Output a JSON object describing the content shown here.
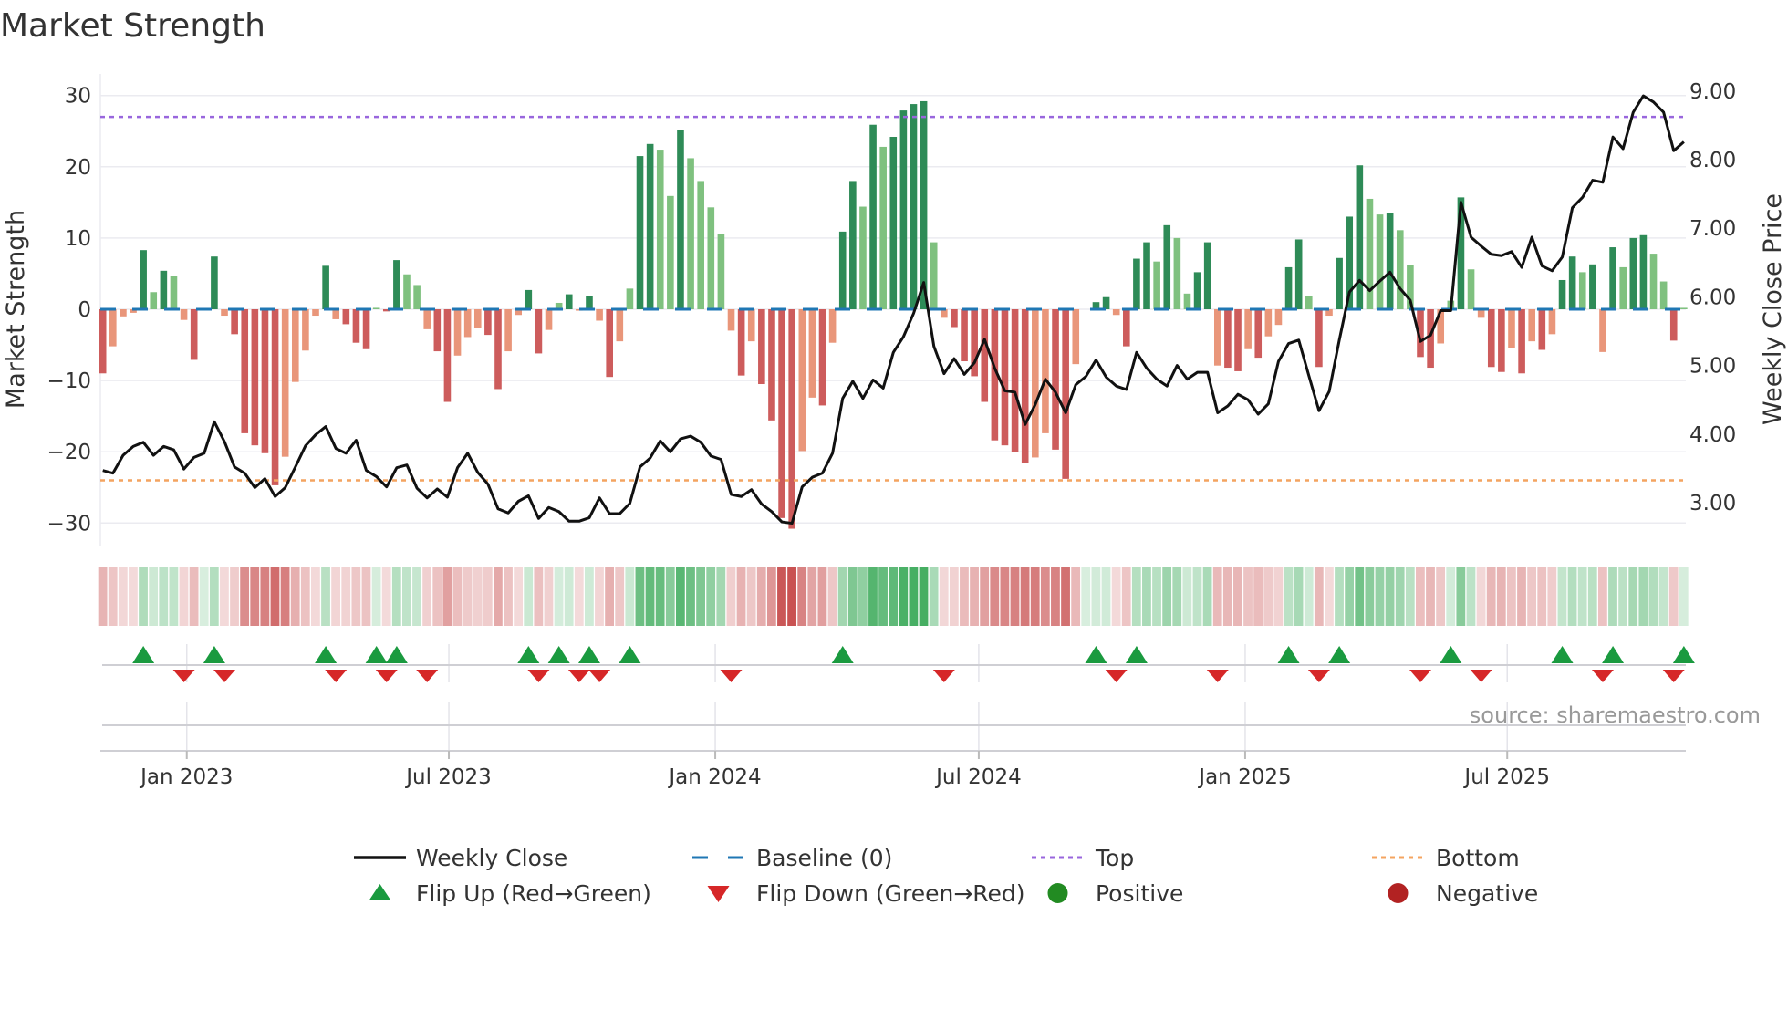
{
  "chart_data": {
    "type": "bar",
    "title": "Market Strength",
    "ylabel": "Market Strength",
    "y2label": "Weekly Close Price",
    "ylim": [
      -33,
      32
    ],
    "y2lim": [
      2.7,
      9.25
    ],
    "yticks": [
      "30",
      "20",
      "10",
      "0",
      "−10",
      "−20",
      "−30"
    ],
    "ytick_values": [
      30,
      20,
      10,
      0,
      -10,
      -20,
      -30
    ],
    "y2ticks": [
      "9.00",
      "8.00",
      "7.00",
      "6.00",
      "5.00",
      "4.00",
      "3.00"
    ],
    "y2tick_values": [
      9,
      8,
      7,
      6,
      5,
      4,
      3
    ],
    "xticks": [
      "Jan 2023",
      "Jul 2023",
      "Jan 2024",
      "Jul 2024",
      "Jan 2025",
      "Jul 2025"
    ],
    "xtick_dates": [
      "2023-01-01",
      "2023-07-01",
      "2024-01-01",
      "2024-07-01",
      "2025-01-01",
      "2025-07-01"
    ],
    "grid": true,
    "legend_position": "bottom",
    "top_level": 27,
    "bottom_level": -24,
    "baseline": 0,
    "colors": {
      "strong_green": "#2e8b57",
      "weak_green": "#7fc17f",
      "strong_red": "#cd5c5c",
      "weak_red": "#e9967a",
      "baseline": "#1f77b4",
      "top": "#9966dd",
      "bottom": "#f4a460",
      "close": "#111111",
      "flip_up": "#1a9a3f",
      "flip_down": "#d62728",
      "positive": "#228b22",
      "negative": "#b22222"
    },
    "dates": [
      "2022-11-04",
      "2022-11-11",
      "2022-11-18",
      "2022-11-25",
      "2022-12-02",
      "2022-12-09",
      "2022-12-16",
      "2022-12-23",
      "2022-12-30",
      "2023-01-06",
      "2023-01-13",
      "2023-01-20",
      "2023-01-27",
      "2023-02-03",
      "2023-02-10",
      "2023-02-17",
      "2023-02-24",
      "2023-03-03",
      "2023-03-10",
      "2023-03-17",
      "2023-03-24",
      "2023-03-31",
      "2023-04-07",
      "2023-04-14",
      "2023-04-21",
      "2023-04-28",
      "2023-05-05",
      "2023-05-12",
      "2023-05-19",
      "2023-05-26",
      "2023-06-02",
      "2023-06-09",
      "2023-06-16",
      "2023-06-23",
      "2023-06-30",
      "2023-07-07",
      "2023-07-14",
      "2023-07-21",
      "2023-07-28",
      "2023-08-04",
      "2023-08-11",
      "2023-08-18",
      "2023-08-25",
      "2023-09-01",
      "2023-09-08",
      "2023-09-15",
      "2023-09-22",
      "2023-09-29",
      "2023-10-06",
      "2023-10-13",
      "2023-10-20",
      "2023-10-27",
      "2023-11-03",
      "2023-11-10",
      "2023-11-17",
      "2023-11-24",
      "2023-12-01",
      "2023-12-08",
      "2023-12-15",
      "2023-12-22",
      "2023-12-29",
      "2024-01-05",
      "2024-01-12",
      "2024-01-19",
      "2024-01-26",
      "2024-02-02",
      "2024-02-09",
      "2024-02-16",
      "2024-02-23",
      "2024-03-01",
      "2024-03-08",
      "2024-03-15",
      "2024-03-22",
      "2024-03-29",
      "2024-04-05",
      "2024-04-12",
      "2024-04-19",
      "2024-04-26",
      "2024-05-03",
      "2024-05-10",
      "2024-05-17",
      "2024-05-24",
      "2024-05-31",
      "2024-06-07",
      "2024-06-14",
      "2024-06-21",
      "2024-06-28",
      "2024-07-05",
      "2024-07-12",
      "2024-07-19",
      "2024-07-26",
      "2024-08-02",
      "2024-08-09",
      "2024-08-16",
      "2024-08-23",
      "2024-08-30",
      "2024-09-06",
      "2024-09-13",
      "2024-09-20",
      "2024-09-27",
      "2024-10-04",
      "2024-10-11",
      "2024-10-18",
      "2024-10-25",
      "2024-11-01",
      "2024-11-08",
      "2024-11-15",
      "2024-11-22",
      "2024-11-29",
      "2024-12-06",
      "2024-12-13",
      "2024-12-20",
      "2024-12-27",
      "2025-01-03",
      "2025-01-10",
      "2025-01-17",
      "2025-01-24",
      "2025-01-31",
      "2025-02-07",
      "2025-02-14",
      "2025-02-21",
      "2025-02-28",
      "2025-03-07",
      "2025-03-14",
      "2025-03-21",
      "2025-03-28",
      "2025-04-04",
      "2025-04-11",
      "2025-04-18",
      "2025-04-25",
      "2025-05-02",
      "2025-05-09",
      "2025-05-16",
      "2025-05-23",
      "2025-05-30",
      "2025-06-06",
      "2025-06-13",
      "2025-06-20",
      "2025-06-27",
      "2025-07-04",
      "2025-07-11",
      "2025-07-18",
      "2025-07-25",
      "2025-08-01",
      "2025-08-08",
      "2025-08-15",
      "2025-08-22",
      "2025-08-29",
      "2025-09-05",
      "2025-09-12",
      "2025-09-19",
      "2025-09-26",
      "2025-10-03",
      "2025-10-10",
      "2025-10-17",
      "2025-10-24",
      "2025-10-31"
    ],
    "series": [
      {
        "name": "Market Strength",
        "values": [
          -9.0,
          -5.2,
          -1.0,
          -0.5,
          8.3,
          2.4,
          5.4,
          4.7,
          -1.5,
          -7.1,
          0,
          7.4,
          -0.9,
          -3.5,
          -17.4,
          -19.1,
          -20.2,
          -24.7,
          -20.7,
          -10.2,
          -5.8,
          -0.9,
          6.1,
          -1.4,
          -2.1,
          -4.7,
          -5.6,
          0.2,
          -0.3,
          6.9,
          4.9,
          3.4,
          -2.8,
          -5.9,
          -13.0,
          -6.5,
          -3.9,
          -2.6,
          -3.6,
          -11.2,
          -5.9,
          -0.8,
          2.7,
          -6.2,
          -2.9,
          0.9,
          2.1,
          -0.2,
          1.9,
          -1.6,
          -9.5,
          -4.5,
          2.9,
          21.5,
          23.2,
          22.4,
          15.9,
          25.1,
          21.2,
          18.0,
          14.3,
          10.6,
          -3.0,
          -9.3,
          -4.5,
          -10.5,
          -15.6,
          -29.3,
          -30.8,
          -19.9,
          -12.4,
          -13.5,
          -4.7,
          10.9,
          18.0,
          14.4,
          25.9,
          22.8,
          24.2,
          27.9,
          28.8,
          29.2,
          9.4,
          -1.2,
          -2.5,
          -7.3,
          -9.4,
          -13.0,
          -18.4,
          -19.1,
          -20.1,
          -21.6,
          -20.8,
          -17.4,
          -19.7,
          -23.8,
          -7.7,
          0,
          1.0,
          1.7,
          -0.8,
          -5.2,
          7.1,
          9.4,
          6.7,
          11.8,
          10.0,
          2.2,
          5.2,
          9.4,
          -7.9,
          -8.2,
          -8.7,
          -5.6,
          -6.8,
          -3.8,
          -2.2,
          5.9,
          9.8,
          1.9,
          -8.1,
          -0.9,
          7.2,
          13.0,
          20.2,
          15.5,
          13.3,
          13.5,
          11.1,
          6.2,
          -6.7,
          -8.2,
          -4.8,
          1.2,
          15.7,
          5.6,
          -1.2,
          -8.1,
          -8.8,
          -5.5,
          -9.0,
          -4.5,
          -5.7,
          -3.5,
          4.1,
          7.4,
          5.2,
          6.3,
          -6.0,
          8.7,
          5.9,
          10.0,
          10.4,
          7.8,
          3.9,
          -4.4,
          0.2
        ]
      },
      {
        "name": "Weekly Close",
        "axis": "right",
        "values": [
          3.47,
          3.43,
          3.69,
          3.82,
          3.88,
          3.69,
          3.82,
          3.77,
          3.49,
          3.66,
          3.72,
          4.18,
          3.89,
          3.52,
          3.43,
          3.22,
          3.35,
          3.09,
          3.22,
          3.52,
          3.83,
          3.99,
          4.11,
          3.79,
          3.72,
          3.91,
          3.47,
          3.38,
          3.23,
          3.51,
          3.55,
          3.21,
          3.07,
          3.2,
          3.08,
          3.51,
          3.72,
          3.44,
          3.27,
          2.91,
          2.85,
          3.02,
          3.1,
          2.77,
          2.93,
          2.87,
          2.73,
          2.73,
          2.78,
          3.07,
          2.84,
          2.84,
          2.99,
          3.52,
          3.65,
          3.9,
          3.74,
          3.93,
          3.97,
          3.88,
          3.68,
          3.63,
          3.12,
          3.09,
          3.19,
          2.98,
          2.87,
          2.72,
          2.7,
          3.23,
          3.37,
          3.43,
          3.72,
          4.52,
          4.77,
          4.52,
          4.79,
          4.67,
          5.19,
          5.42,
          5.76,
          6.21,
          5.28,
          4.88,
          5.1,
          4.87,
          5.04,
          5.38,
          4.96,
          4.63,
          4.61,
          4.14,
          4.43,
          4.8,
          4.61,
          4.31,
          4.72,
          4.84,
          5.08,
          4.83,
          4.7,
          4.65,
          5.19,
          4.96,
          4.8,
          4.7,
          5.0,
          4.8,
          4.9,
          4.9,
          4.31,
          4.41,
          4.58,
          4.5,
          4.29,
          4.44,
          5.06,
          5.32,
          5.37,
          4.85,
          4.34,
          4.62,
          5.37,
          6.07,
          6.24,
          6.09,
          6.23,
          6.36,
          6.12,
          5.95,
          5.35,
          5.44,
          5.8,
          5.8,
          7.38,
          6.87,
          6.74,
          6.62,
          6.6,
          6.66,
          6.43,
          6.87,
          6.45,
          6.38,
          6.58,
          7.3,
          7.45,
          7.7,
          7.67,
          8.33,
          8.16,
          8.69,
          8.93,
          8.84,
          8.69,
          8.13,
          8.26
        ]
      }
    ]
  },
  "legend": [
    {
      "label": "Weekly Close",
      "kind": "line"
    },
    {
      "label": "Baseline (0)",
      "kind": "dash"
    },
    {
      "label": "Top",
      "kind": "dot-top"
    },
    {
      "label": "Bottom",
      "kind": "dot-bottom"
    },
    {
      "label": "Flip Up (Red→Green)",
      "kind": "tri-up"
    },
    {
      "label": "Flip Down (Green→Red)",
      "kind": "tri-down"
    },
    {
      "label": "Positive",
      "kind": "circle-pos"
    },
    {
      "label": "Negative",
      "kind": "circle-neg"
    }
  ],
  "source": "source: sharemaestro.com"
}
